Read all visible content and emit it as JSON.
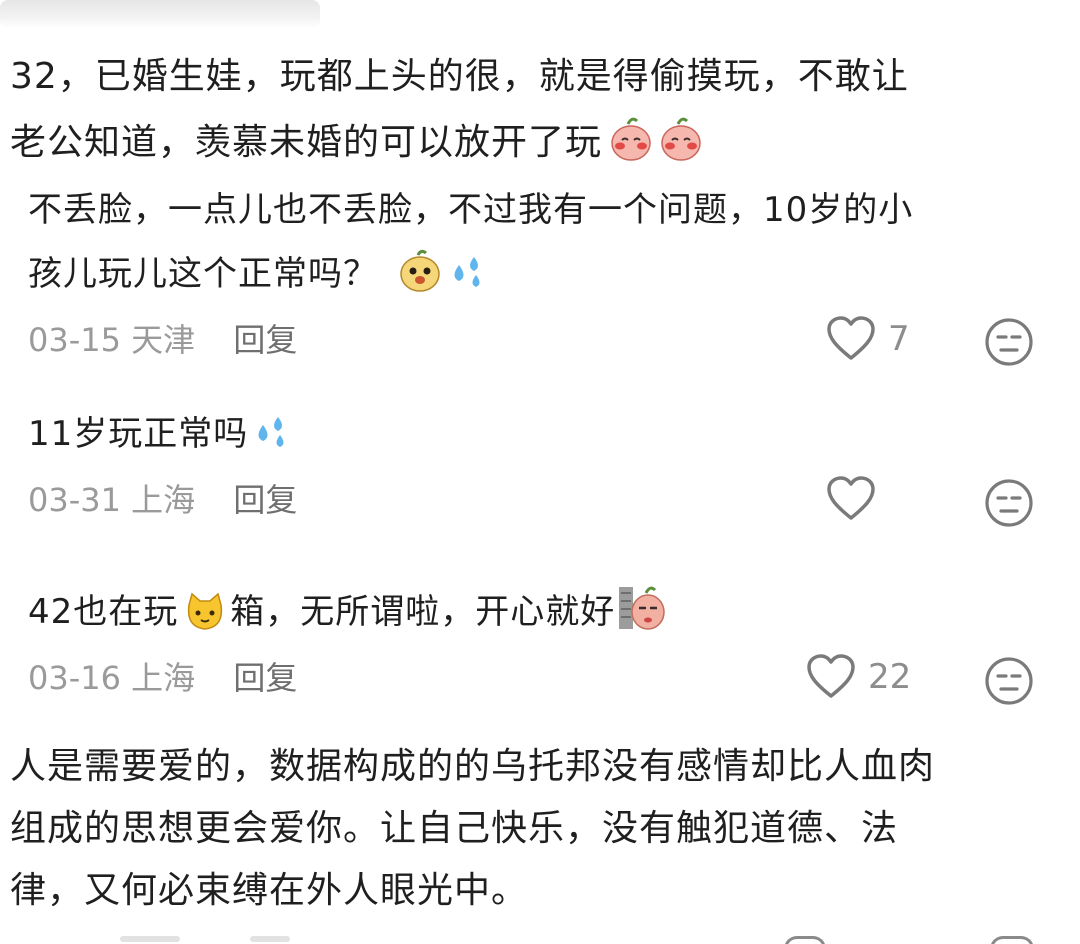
{
  "post": {
    "lines": [
      "32，已婚生娃，玩都上头的很，就是得偷摸玩，不敢让",
      "老公知道，羡慕未婚的可以放开了玩"
    ]
  },
  "comments": [
    {
      "lines": [
        "不丢脸，一点儿也不丢脸，不过我有一个问题，10岁的小",
        "孩儿玩儿这个正常吗？"
      ],
      "date": "03-15 天津",
      "reply_label": "回复",
      "likes": "7"
    },
    {
      "lines": [
        "11岁玩正常吗"
      ],
      "date": "03-31 上海",
      "reply_label": "回复",
      "likes": ""
    },
    {
      "lines": [
        "42也在玩",
        "箱，无所谓啦，开心就好"
      ],
      "date": "03-16 上海",
      "reply_label": "回复",
      "likes": "22"
    }
  ],
  "post2": {
    "lines": [
      "人是需要爱的，数据构成的的乌托邦没有感情却比人血肉",
      "组成的思想更会爱你。让自己快乐，没有触犯道德、法",
      "律，又何必束缚在外人眼光中。"
    ]
  },
  "colors": {
    "text": "#1f1f1f",
    "meta": "#9a9a9a",
    "reply": "#6f6f6f",
    "icon": "#7a7a7a"
  },
  "icons": [
    "heart-icon",
    "meh-face-icon",
    "sweat-drops-emoji",
    "blush-peach-emoji",
    "puppy-face-emoji",
    "cat-face-emoji",
    "peeking-emoji"
  ]
}
